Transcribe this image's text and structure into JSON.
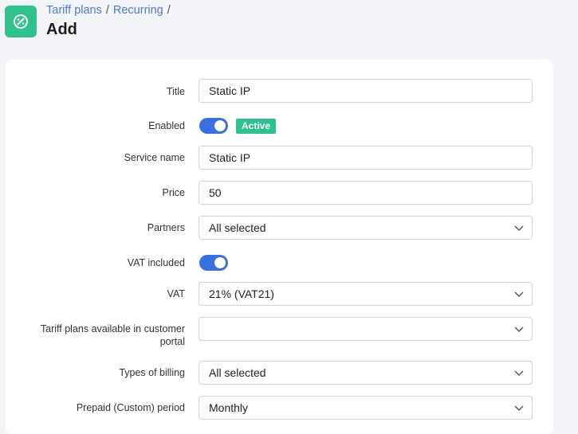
{
  "header": {
    "breadcrumb": [
      "Tariff plans",
      "Recurring"
    ],
    "separator": "/",
    "title": "Add",
    "icon": "percent-badge-icon",
    "accent": "#2fc18c"
  },
  "form": {
    "title": {
      "label": "Title",
      "value": "Static IP"
    },
    "enabled": {
      "label": "Enabled",
      "on": true,
      "badge": "Active"
    },
    "service_name": {
      "label": "Service name",
      "value": "Static IP"
    },
    "price": {
      "label": "Price",
      "value": "50"
    },
    "partners": {
      "label": "Partners",
      "value": "All selected"
    },
    "vat_included": {
      "label": "VAT included",
      "on": true
    },
    "vat": {
      "label": "VAT",
      "value": "21% (VAT21)"
    },
    "portal_plans": {
      "label_line1": "Tariff plans available in customer",
      "label_line2": "portal",
      "value": ""
    },
    "billing_types": {
      "label": "Types of billing",
      "value": "All selected"
    },
    "prepaid_period": {
      "label": "Prepaid (Custom) period",
      "value": "Monthly"
    }
  },
  "colors": {
    "toggle": "#3a6fe0",
    "badge": "#2fc18c",
    "link": "#4a7ad8"
  }
}
